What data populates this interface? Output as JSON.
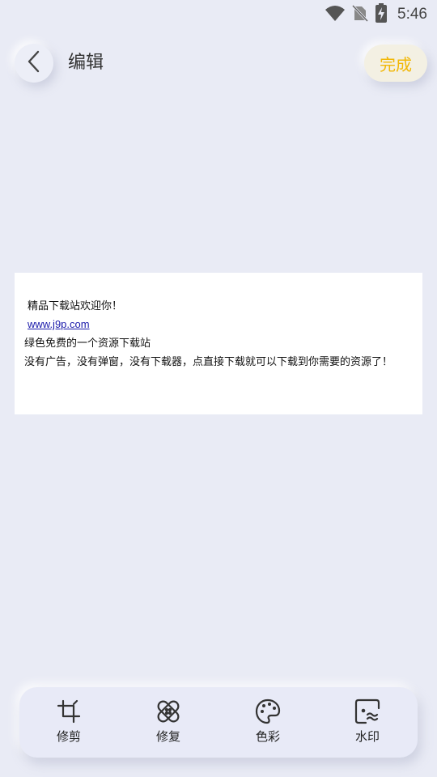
{
  "status_bar": {
    "time": "5:46",
    "icons": [
      "wifi-icon",
      "no-sim-icon",
      "battery-charging-icon"
    ]
  },
  "header": {
    "back_icon": "chevron-left-icon",
    "title": "编辑",
    "done_label": "完成"
  },
  "canvas": {
    "lines": [
      "精品下载站欢迎你！",
      "www.j9p.com",
      "绿色免费的一个资源下载站",
      "没有广告，没有弹窗，没有下载器，点直接下载就可以下载到你需要的资源了！"
    ]
  },
  "toolbar": {
    "items": [
      {
        "label": "修剪",
        "icon": "crop-icon"
      },
      {
        "label": "修复",
        "icon": "bandage-icon"
      },
      {
        "label": "色彩",
        "icon": "palette-icon"
      },
      {
        "label": "水印",
        "icon": "watermark-icon"
      }
    ]
  },
  "colors": {
    "background": "#e9ebf5",
    "accent": "#f2b705",
    "link": "#1a1aaa"
  }
}
